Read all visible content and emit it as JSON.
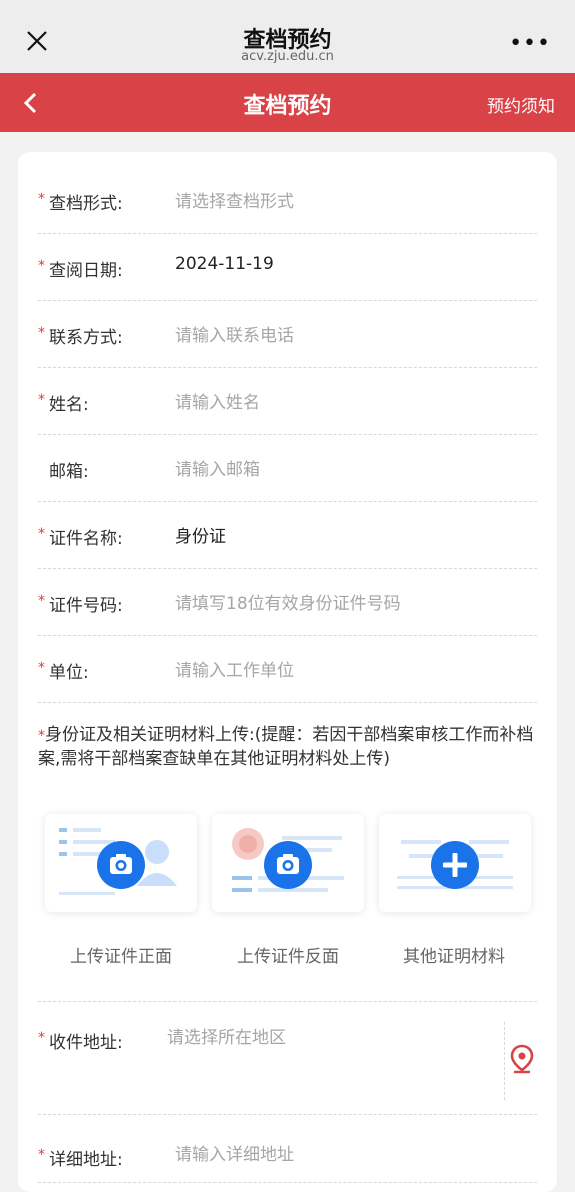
{
  "wechat": {
    "title": "查档预约",
    "domain": "acv.zju.edu.cn",
    "more": "•••"
  },
  "nav": {
    "title": "查档预约",
    "notice": "预约须知"
  },
  "form": {
    "fields": [
      {
        "label": "查档形式:",
        "placeholder": "请选择查档形式",
        "value": "",
        "required": "*"
      },
      {
        "label": "查阅日期:",
        "placeholder": "",
        "value": "2024-11-19",
        "required": "*"
      },
      {
        "label": "联系方式:",
        "placeholder": "请输入联系电话",
        "value": "",
        "required": "*"
      },
      {
        "label": "姓名:",
        "placeholder": "请输入姓名",
        "value": "",
        "required": "*"
      },
      {
        "label": "邮箱:",
        "placeholder": "请输入邮箱",
        "value": "",
        "required": ""
      },
      {
        "label": "证件名称:",
        "placeholder": "",
        "value": "身份证",
        "required": "*"
      },
      {
        "label": "证件号码:",
        "placeholder": "请填写18位有效身份证件号码",
        "value": "",
        "required": "*"
      },
      {
        "label": "单位:",
        "placeholder": "请输入工作单位",
        "value": "",
        "required": "*"
      }
    ],
    "upload_note": "身份证及相关证明材料上传:(提醒：若因干部档案审核工作而补档案,需将干部档案查缺单在其他证明材料处上传)",
    "upload_required": "*",
    "uploads": [
      {
        "label": "上传证件正面"
      },
      {
        "label": "上传证件反面"
      },
      {
        "label": "其他证明材料"
      }
    ],
    "address": {
      "label": "收件地址:",
      "placeholder": "请选择所在地区",
      "required": "*"
    },
    "detail_address": {
      "label": "详细地址:",
      "placeholder": "请输入详细地址",
      "required": "*"
    }
  },
  "colors": {
    "brand_red": "#d94246",
    "upload_blue": "#1a73e8"
  }
}
